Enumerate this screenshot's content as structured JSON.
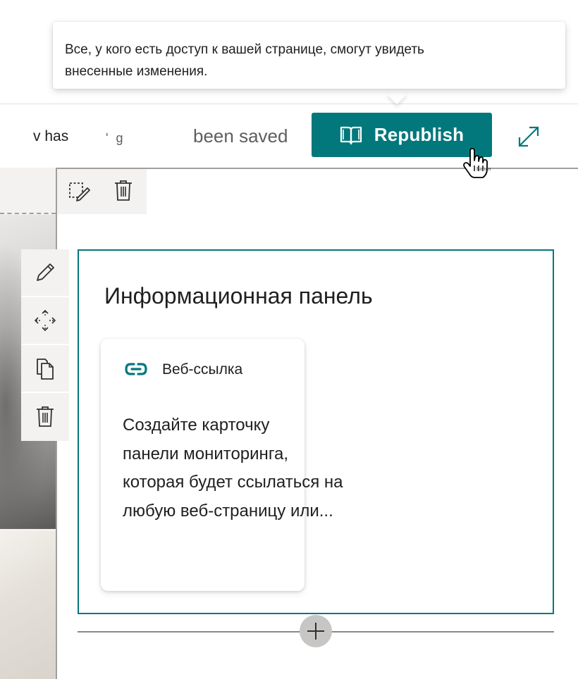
{
  "callout": {
    "text": "Все, у кого есть доступ к вашей странице, смогут увидеть внесенные изменения."
  },
  "command_bar": {
    "status_left": "v has",
    "status_fragment": "' g",
    "status_saved": "been saved",
    "republish_label": "Republish",
    "cursor_tooltip": "Болен"
  },
  "webpart": {
    "title": "Информационная панель",
    "card": {
      "type_label": "Веб-ссылка",
      "description_lines": [
        "Создайте карточку",
        "панели мониторинга,",
        "которая будет ссылаться на",
        "любую веб-страницу или..."
      ]
    }
  },
  "icons": {
    "republish": "open-book-icon",
    "expand": "expand-arrows-icon",
    "section_edit": "edit-section-icon",
    "section_delete": "trash-icon",
    "wp_edit": "pencil-icon",
    "wp_move": "move-icon",
    "wp_copy": "copy-icon",
    "wp_delete": "trash-icon",
    "card_type": "link-icon",
    "add": "plus-icon"
  },
  "colors": {
    "accent": "#03787c",
    "toolbar_bg": "#f3f2f1",
    "frame_gray": "#a19f9d"
  }
}
